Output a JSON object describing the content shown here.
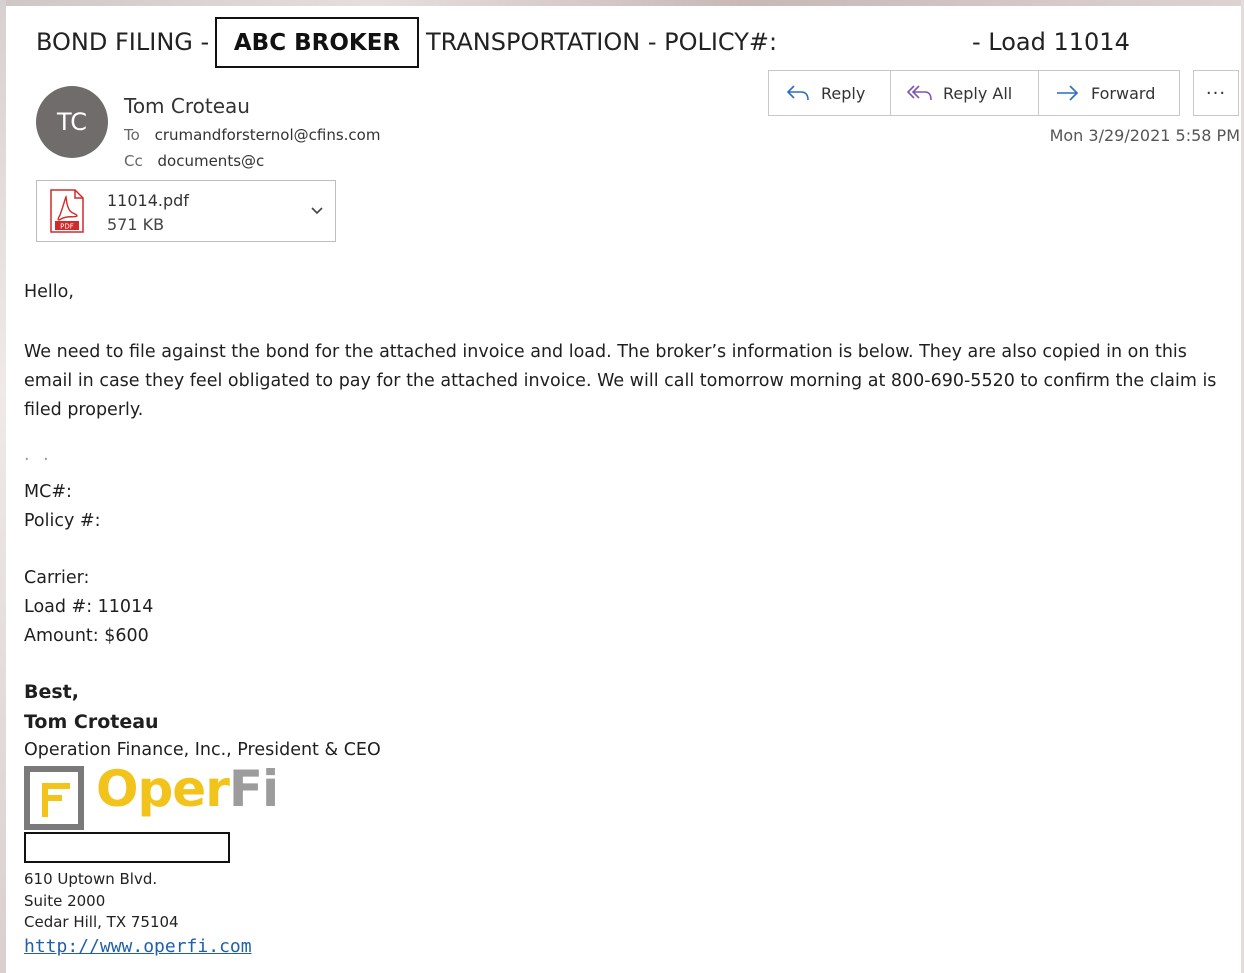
{
  "subject": {
    "part1": "BOND FILING -",
    "part2": "TRANSPORTATION - POLICY#: ",
    "part3": "- Load 11014",
    "redacted_label": "ABC BROKER"
  },
  "sender": {
    "initials": "TC",
    "name": "Tom Croteau",
    "to_label": "To",
    "to_value": "crumandforsternol@cfins.com",
    "cc_label": "Cc",
    "cc_value": "documents@c"
  },
  "actions": {
    "reply": "Reply",
    "reply_all": "Reply All",
    "forward": "Forward",
    "more": "···"
  },
  "timestamp": "Mon 3/29/2021 5:58 PM",
  "attachment": {
    "name_visible": "11014.pdf",
    "size": "571 KB",
    "icon_label": "PDF"
  },
  "body": {
    "greeting": "Hello,",
    "paragraph": "We need to file against the bond for the attached invoice and load. The broker’s information is below. They are also copied in on this email in case they feel obligated to pay for the attached invoice. We will call tomorrow morning at 800-690-5520 to confirm the claim is filed properly.",
    "mc_label": "MC#: ",
    "policy_label": "Policy #: ",
    "carrier_label": "Carrier: ",
    "load_line": "Load #: 11014",
    "amount_line": "Amount: $600"
  },
  "signature": {
    "closing": "Best,",
    "name": "Tom Croteau",
    "title": "Operation Finance, Inc., President & CEO",
    "logo_part1": "Oper",
    "logo_part2": "Fi",
    "address1": "610 Uptown Blvd.",
    "address2": "Suite 2000",
    "address3": "Cedar Hill, TX 75104",
    "url": "http://www.operfi.com"
  },
  "colors": {
    "avatar_bg": "#706c6c",
    "link": "#1f5fae",
    "pdf_red": "#d22a2a",
    "logo_yellow": "#f2c41b",
    "logo_gray": "#9c9c9c"
  }
}
